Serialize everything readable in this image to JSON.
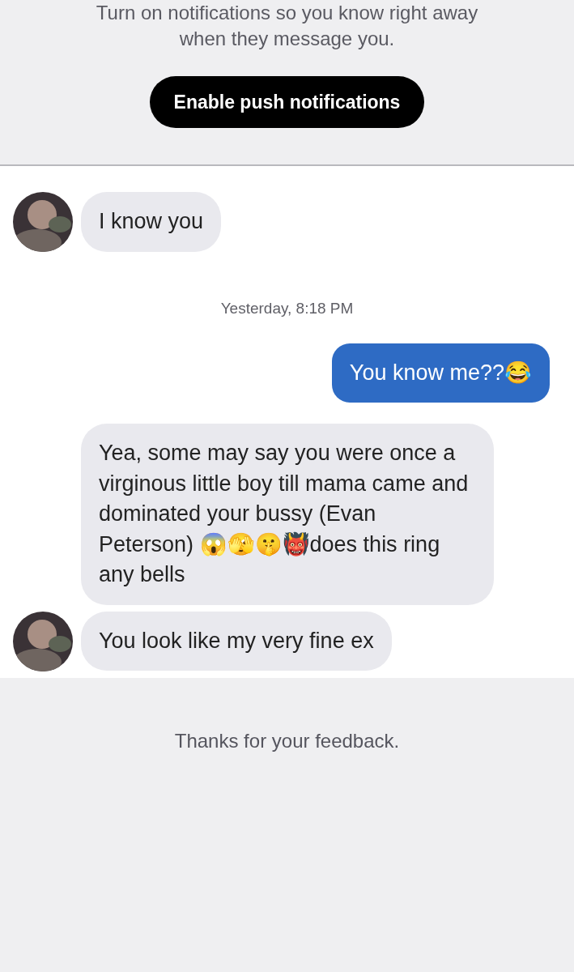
{
  "notice": {
    "text": "Turn on notifications so you know right away when they message you.",
    "button": "Enable push notifications"
  },
  "messages": [
    {
      "kind": "incoming",
      "avatar": true,
      "text": "I know you"
    },
    {
      "kind": "timestamp",
      "text": "Yesterday, 8:18 PM"
    },
    {
      "kind": "outgoing",
      "text": "You know me??😂"
    },
    {
      "kind": "incoming",
      "avatar": false,
      "text": "Yea, some may say you were once a virginous little boy till mama came and dominated your bussy (Evan Peterson) 😱🫣🤫👹does this ring any bells"
    },
    {
      "kind": "incoming",
      "avatar": true,
      "text": "You look like my very fine ex"
    }
  ],
  "footer": {
    "text": "Thanks for your feedback."
  }
}
